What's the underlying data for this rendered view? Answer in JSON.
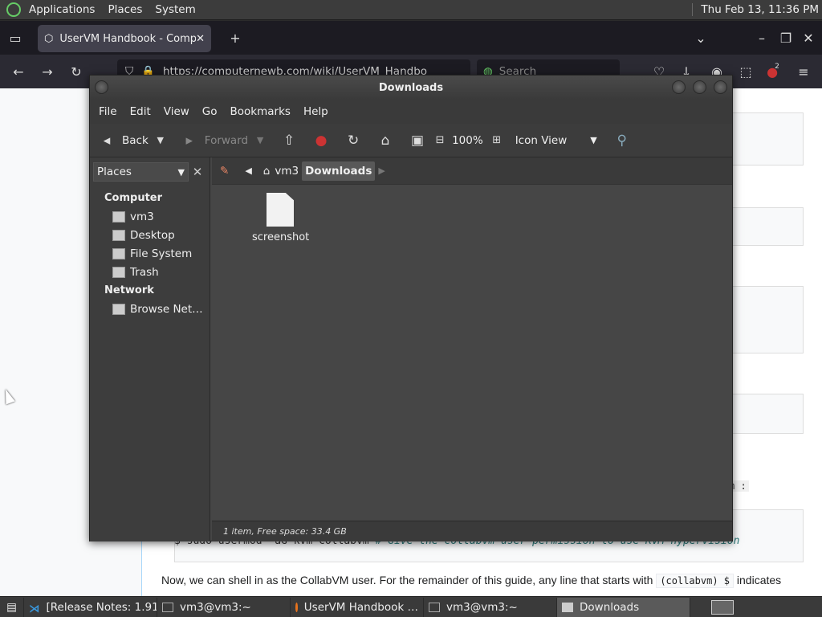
{
  "top_panel": {
    "menus": [
      "Applications",
      "Places",
      "System"
    ],
    "clock": "Thu Feb 13, 11:36 PM"
  },
  "browser": {
    "tab_title": "UserVM Handbook - Compu",
    "url": "https://computernewb.com/wiki/UserVM_Handbo",
    "search_placeholder": "Search",
    "ext_badge": "2"
  },
  "webpage": {
    "inline_tail": "m :",
    "command": "$ sudo usermod -aG kvm collabvm",
    "command_comment": "# Give the collabvm user permission to use KVM hypervision",
    "para_text": "Now, we can shell in as the CollabVM user. For the remainder of this guide, any line that starts with",
    "para_code": "(collabvm) $",
    "para_end": "indicates"
  },
  "file_manager": {
    "title": "Downloads",
    "menu": [
      "File",
      "Edit",
      "View",
      "Go",
      "Bookmarks",
      "Help"
    ],
    "toolbar": {
      "back": "Back",
      "forward": "Forward",
      "zoom": "100%",
      "view_mode": "Icon View"
    },
    "places_label": "Places",
    "sidebar": {
      "computer_header": "Computer",
      "computer_items": [
        "vm3",
        "Desktop",
        "File System",
        "Trash"
      ],
      "network_header": "Network",
      "network_items": [
        "Browse Net…"
      ]
    },
    "path": [
      "vm3",
      "Downloads"
    ],
    "files": [
      {
        "name": "screenshot"
      }
    ],
    "status": "1 item, Free space: 33.4 GB"
  },
  "taskbar": {
    "items": [
      {
        "label": "[Release Notes: 1.91…",
        "active": false
      },
      {
        "label": "vm3@vm3:~",
        "active": false
      },
      {
        "label": "UserVM Handbook …",
        "active": false
      },
      {
        "label": "vm3@vm3:~",
        "active": false
      },
      {
        "label": "Downloads",
        "active": true
      }
    ]
  }
}
